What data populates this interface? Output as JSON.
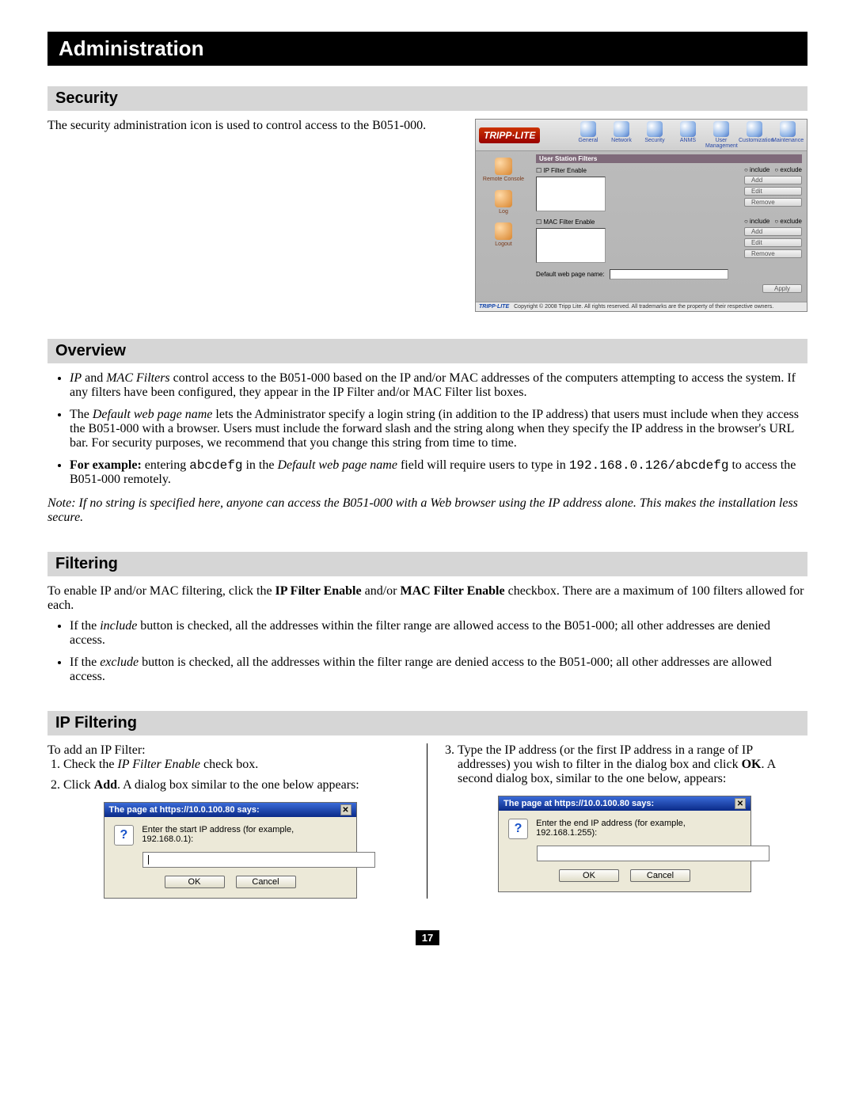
{
  "title": "Administration",
  "security": {
    "heading": "Security",
    "intro": "The security administration icon is used to control access to the B051-000."
  },
  "app": {
    "brand": "TRIPP·LITE",
    "topnav": [
      "General",
      "Network",
      "Security",
      "ANMS",
      "User Management",
      "Customization",
      "Maintenance"
    ],
    "side": [
      {
        "label": "Remote Console"
      },
      {
        "label": "Log"
      },
      {
        "label": "Logout"
      }
    ],
    "panel_title": "User Station Filters",
    "ip_label": "IP Filter Enable",
    "mac_label": "MAC Filter Enable",
    "include": "include",
    "exclude": "exclude",
    "btn_add": "Add",
    "btn_edit": "Edit",
    "btn_remove": "Remove",
    "default_label": "Default web page name:",
    "apply": "Apply",
    "footer_brand": "TRIPP·LITE",
    "footer_text": "Copyright © 2008 Tripp Lite. All rights reserved. All trademarks are the property of their respective owners."
  },
  "overview": {
    "heading": "Overview",
    "b1_pre": "",
    "b1_ip": "IP",
    "b1_and": " and ",
    "b1_mac": "MAC Filters",
    "b1_post": " control access to the B051-000 based on the IP and/or MAC addresses of the computers attempting to access the system. If any filters have been configured, they appear in the IP Filter and/or MAC Filter list boxes.",
    "b2_pre": "The ",
    "b2_em": "Default web page name",
    "b2_post": " lets the Administrator specify a login string (in addition to the IP address) that users must include when they access the B051-000 with a browser. Users must include the forward slash and the string along when they specify the IP address in the browser's URL bar. For security purposes, we recommend that you change this string from time to time.",
    "b3_lead": "For example:",
    "b3_t1": " entering ",
    "b3_code1": "abcdefg",
    "b3_t2": " in the ",
    "b3_em": "Default web page name",
    "b3_t3": " field will require users to type in ",
    "b3_code2": "192.168.0.126/abcdefg",
    "b3_t4": " to access the B051-000 remotely.",
    "note": "Note: If no string is specified here, anyone can access the B051-000 with a Web browser using the IP address alone. This makes the installation less secure."
  },
  "filtering": {
    "heading": "Filtering",
    "intro_pre": "To enable IP and/or MAC filtering, click the ",
    "intro_b1": "IP Filter Enable",
    "intro_mid": " and/or ",
    "intro_b2": "MAC Filter Enable",
    "intro_post": " checkbox. There are a maximum of 100 filters allowed for each.",
    "li1_pre": "If the ",
    "li1_em": "include",
    "li1_post": " button is checked, all the addresses within the filter range are allowed access to the B051-000; all other addresses are denied access.",
    "li2_pre": "If the ",
    "li2_em": "exclude",
    "li2_post": " button is checked, all the addresses within the filter range are denied access to the B051-000; all other addresses are allowed access."
  },
  "ipfilter": {
    "heading": "IP Filtering",
    "left_intro": "To add an IP Filter:",
    "l1_pre": "Check the ",
    "l1_em": "IP Filter Enable",
    "l1_post": " check box.",
    "l2_pre": "Click ",
    "l2_b": "Add",
    "l2_post": ". A dialog box similar to the one below appears:",
    "r3_pre": "Type the IP address (or the first IP address in a range of IP addresses) you wish to filter in the dialog box and click ",
    "r3_b": "OK",
    "r3_post": ". A second dialog box, similar to the one below, appears:"
  },
  "dialog": {
    "title": "The page at https://10.0.100.80 says:",
    "prompt_start": "Enter the start IP address (for example, 192.168.0.1):",
    "prompt_end": "Enter the end IP address (for example, 192.168.1.255):",
    "ok": "OK",
    "cancel": "Cancel"
  },
  "pagenum": "17"
}
